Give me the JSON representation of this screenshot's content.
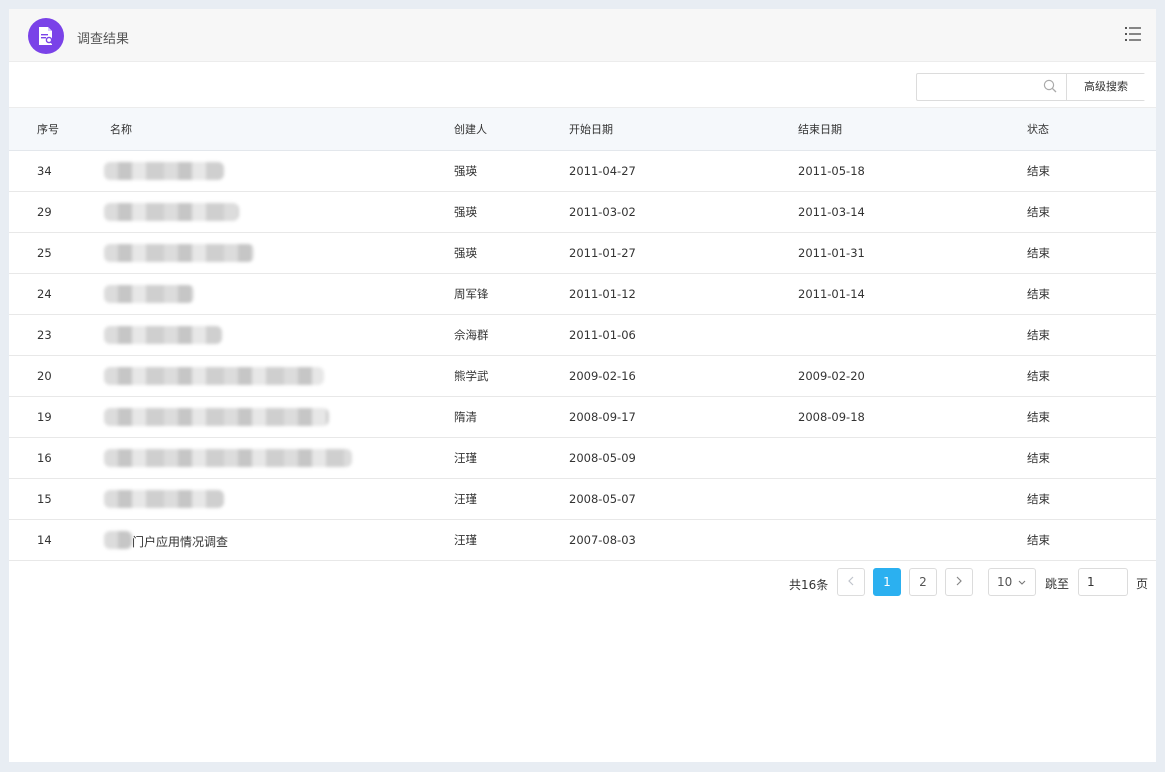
{
  "header": {
    "title": "调查结果",
    "logo_icon": "document-search-icon",
    "menu_icon": "list-menu-icon",
    "accent": "#7a42e8"
  },
  "search": {
    "placeholder": "",
    "value": "",
    "advanced_label": "高级搜索"
  },
  "table": {
    "columns": [
      "序号",
      "名称",
      "创建人",
      "开始日期",
      "结束日期",
      "状态"
    ],
    "rows": [
      {
        "id": "34",
        "name": "",
        "creator": "强瑛",
        "start": "2011-04-27",
        "end": "2011-05-18",
        "status": "结束"
      },
      {
        "id": "29",
        "name": "",
        "creator": "强瑛",
        "start": "2011-03-02",
        "end": "2011-03-14",
        "status": "结束"
      },
      {
        "id": "25",
        "name": "",
        "creator": "强瑛",
        "start": "2011-01-27",
        "end": "2011-01-31",
        "status": "结束"
      },
      {
        "id": "24",
        "name": "",
        "creator": "周军锋",
        "start": "2011-01-12",
        "end": "2011-01-14",
        "status": "结束"
      },
      {
        "id": "23",
        "name": "",
        "creator": "佘海群",
        "start": "2011-01-06",
        "end": "",
        "status": "结束"
      },
      {
        "id": "20",
        "name": "",
        "creator": "熊学武",
        "start": "2009-02-16",
        "end": "2009-02-20",
        "status": "结束"
      },
      {
        "id": "19",
        "name": "",
        "creator": "隋清",
        "start": "2008-09-17",
        "end": "2008-09-18",
        "status": "结束"
      },
      {
        "id": "16",
        "name": "",
        "creator": "汪瑾",
        "start": "2008-05-09",
        "end": "",
        "status": "结束"
      },
      {
        "id": "15",
        "name": "",
        "creator": "汪瑾",
        "start": "2008-05-07",
        "end": "",
        "status": "结束"
      },
      {
        "id": "14",
        "name": "门户应用情况调查",
        "creator": "汪瑾",
        "start": "2007-08-03",
        "end": "",
        "status": "结束"
      }
    ]
  },
  "pagination": {
    "total_label": "共16条",
    "prev_icon": "chevron-left-icon",
    "next_icon": "chevron-right-icon",
    "pages": [
      "1",
      "2"
    ],
    "current_page": "1",
    "page_size": "10",
    "jump_label": "跳至",
    "jump_value": "1",
    "page_suffix": "页",
    "active_color": "#2bb0f0"
  }
}
